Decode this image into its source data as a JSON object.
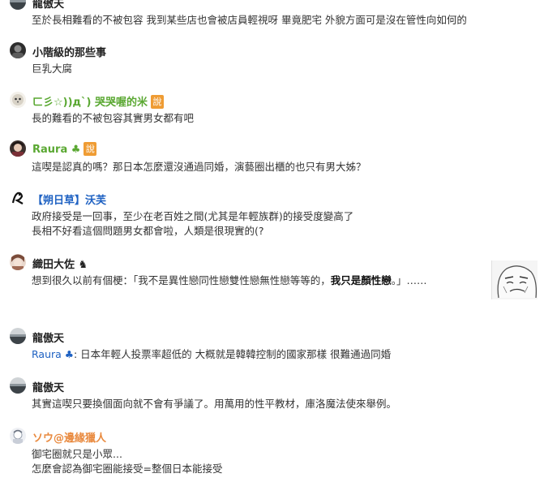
{
  "comments": [
    {
      "name": "龍傲天",
      "lines": [
        "至於長相難看的不被包容 我到某些店也會被店員輕視呀 畢竟肥宅 外貌方面可是沒在管性向如何的"
      ]
    },
    {
      "name": "小階級的那些事",
      "lines": [
        "巨乳大腐"
      ]
    },
    {
      "name": "ㄈ彡☆))д`) 哭哭喔的米",
      "badge": "說",
      "lines": [
        "長的難看的不被包容其實男女都有吧"
      ]
    },
    {
      "name": "Raura",
      "name_suffix": "♣",
      "badge": "說",
      "lines": [
        "這喫是認真的嗎？那日本怎麼還沒通過同婚，演藝圈出櫃的也只有男大姊？"
      ]
    },
    {
      "name": "【朔日草】沃芙",
      "lines": [
        "政府接受是一回事，至少在老百姓之間(尤其是年輕族群)的接受度變高了",
        "長相不好看這個問題男女都會啦，人類是很現實的(?"
      ]
    },
    {
      "name": "織田大佐",
      "name_suffix": "♞",
      "line_parts": {
        "before": "想到很久以前有個梗：「我不是異性戀同性戀雙性戀無性戀等等的，",
        "bold": "我只是顏性戀",
        "after": "。」……"
      }
    },
    {
      "name": "龍傲天",
      "reply_to": "Raura ♣",
      "lines": [
        ": 日本年輕人投票率超低的 大概就是韓韓控制的國家那樣 很難通過同婚"
      ]
    },
    {
      "name": "龍傲天",
      "lines": [
        "其實這喫只要換個面向就不會有爭議了。用萬用的性平教材，庫洛魔法使來舉例。"
      ]
    },
    {
      "name": "ソウ@邊緣獵人",
      "lines": [
        "御宅圈就只是小眾...",
        "怎麼會認為御宅圈能接受=整個日本能接受"
      ]
    }
  ]
}
